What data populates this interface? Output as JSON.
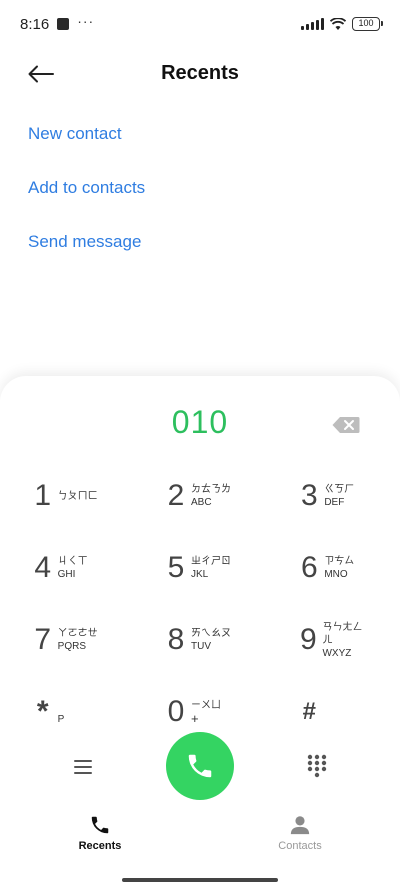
{
  "status_bar": {
    "time": "8:16",
    "dots": "···",
    "battery": "100"
  },
  "header": {
    "title": "Recents",
    "back_icon": "arrow-left-icon"
  },
  "actions": [
    {
      "label": "New contact"
    },
    {
      "label": "Add to contacts"
    },
    {
      "label": "Send message"
    }
  ],
  "dialer": {
    "number": "010",
    "accent_color": "#2dbf5e",
    "keys": [
      {
        "digit": "1",
        "bopomofo": "ㄅㄆㄇㄈ",
        "letters": ""
      },
      {
        "digit": "2",
        "bopomofo": "ㄉㄊㄋㄌ",
        "letters": "ABC"
      },
      {
        "digit": "3",
        "bopomofo": "ㄍㄎㄏ",
        "letters": "DEF"
      },
      {
        "digit": "4",
        "bopomofo": "ㄐㄑㄒ",
        "letters": "GHI"
      },
      {
        "digit": "5",
        "bopomofo": "ㄓㄔㄕㄖ",
        "letters": "JKL"
      },
      {
        "digit": "6",
        "bopomofo": "ㄗㄘㄙ",
        "letters": "MNO"
      },
      {
        "digit": "7",
        "bopomofo": "ㄚㄛㄜㄝ",
        "letters": "PQRS"
      },
      {
        "digit": "8",
        "bopomofo": "ㄞㄟㄠㄡ",
        "letters": "TUV"
      },
      {
        "digit": "9",
        "bopomofo": "ㄢㄣㄤㄥㄦ",
        "letters": "WXYZ"
      },
      {
        "digit": "*",
        "bopomofo": "",
        "letters": "P"
      },
      {
        "digit": "0",
        "bopomofo": "ㄧㄨㄩ",
        "letters": "+"
      },
      {
        "digit": "#",
        "bopomofo": "",
        "letters": ""
      }
    ]
  },
  "controls": {
    "call_color": "#34d462"
  },
  "nav": {
    "recents": "Recents",
    "contacts": "Contacts"
  }
}
